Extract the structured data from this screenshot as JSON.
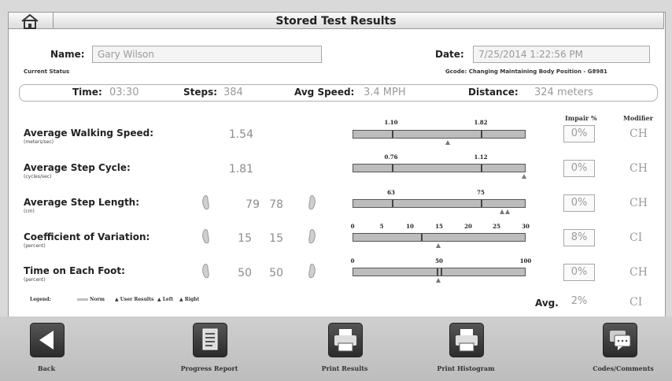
{
  "window": {
    "title": "Stored Test Results"
  },
  "header": {
    "name_label": "Name:",
    "name_value": "Gary Wilson",
    "date_label": "Date:",
    "date_value": "7/25/2014 1:22:56 PM",
    "current_status": "Current Status",
    "gcode": "Gcode: Changing Maintaining Body Position - G8981"
  },
  "stats": {
    "time_label": "Time:",
    "time_value": "03:30",
    "steps_label": "Steps:",
    "steps_value": "384",
    "speed_label": "Avg Speed:",
    "speed_value": "3.4 MPH",
    "distance_label": "Distance:",
    "distance_value": "324 meters"
  },
  "columns": {
    "impair": "Impair %",
    "modifier": "Modifier"
  },
  "metrics": [
    {
      "label": "Average Walking Speed:",
      "unit": "(meters/sec)",
      "value": "1.54",
      "ticks": [
        "1.10",
        "1.82"
      ],
      "impair": "0%",
      "modifier": "CH"
    },
    {
      "label": "Average Step Cycle:",
      "unit": "(cycles/sec)",
      "value": "1.81",
      "ticks": [
        "0.76",
        "1.12"
      ],
      "impair": "0%",
      "modifier": "CH"
    },
    {
      "label": "Average Step Length:",
      "unit": "(cm)",
      "left": "79",
      "right": "78",
      "ticks": [
        "63",
        "75"
      ],
      "impair": "0%",
      "modifier": "CH"
    },
    {
      "label": "Coefficient of Variation:",
      "unit": "(percent)",
      "left": "15",
      "right": "15",
      "ticks": [
        "0",
        "5",
        "10",
        "15",
        "20",
        "25",
        "30"
      ],
      "impair": "8%",
      "modifier": "CI"
    },
    {
      "label": "Time on Each Foot:",
      "unit": "(percent)",
      "left": "50",
      "right": "50",
      "ticks": [
        "0",
        "50",
        "100"
      ],
      "impair": "0%",
      "modifier": "CH"
    }
  ],
  "legend": {
    "title": "Legend:",
    "norm": "Norm",
    "user": "▲ User Results",
    "left": "▲ Left",
    "right": "▲ Right"
  },
  "average": {
    "label": "Avg.",
    "impair": "2%",
    "modifier": "CI"
  },
  "toolbar": {
    "back": "Back",
    "progress": "Progress Report",
    "print_results": "Print Results",
    "print_histogram": "Print Histogram",
    "codes": "Codes/Comments"
  }
}
